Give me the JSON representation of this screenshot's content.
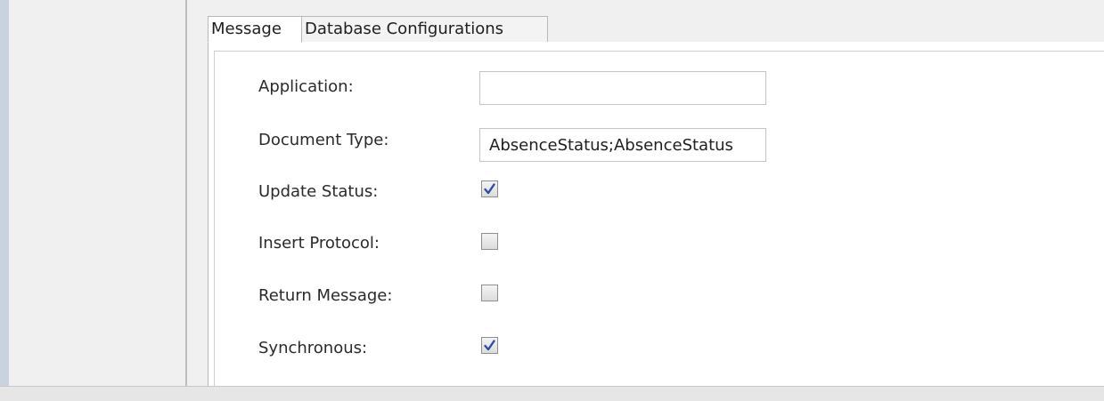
{
  "tabs": [
    {
      "label": "Message",
      "selected": true
    },
    {
      "label": "Database Configurations",
      "selected": false
    }
  ],
  "form": {
    "application": {
      "label": "Application:",
      "value": ""
    },
    "document_type": {
      "label": "Document Type:",
      "value": "AbsenceStatus;AbsenceStatus"
    },
    "update_status": {
      "label": "Update Status:",
      "checked": true
    },
    "insert_protocol": {
      "label": "Insert Protocol:",
      "checked": false
    },
    "return_message": {
      "label": "Return Message:",
      "checked": false
    },
    "synchronous": {
      "label": "Synchronous:",
      "checked": true
    }
  },
  "colors": {
    "check_mark": "#2a4ea8",
    "panel_background": "#f0f0f0",
    "left_border": "#c9d3df"
  }
}
